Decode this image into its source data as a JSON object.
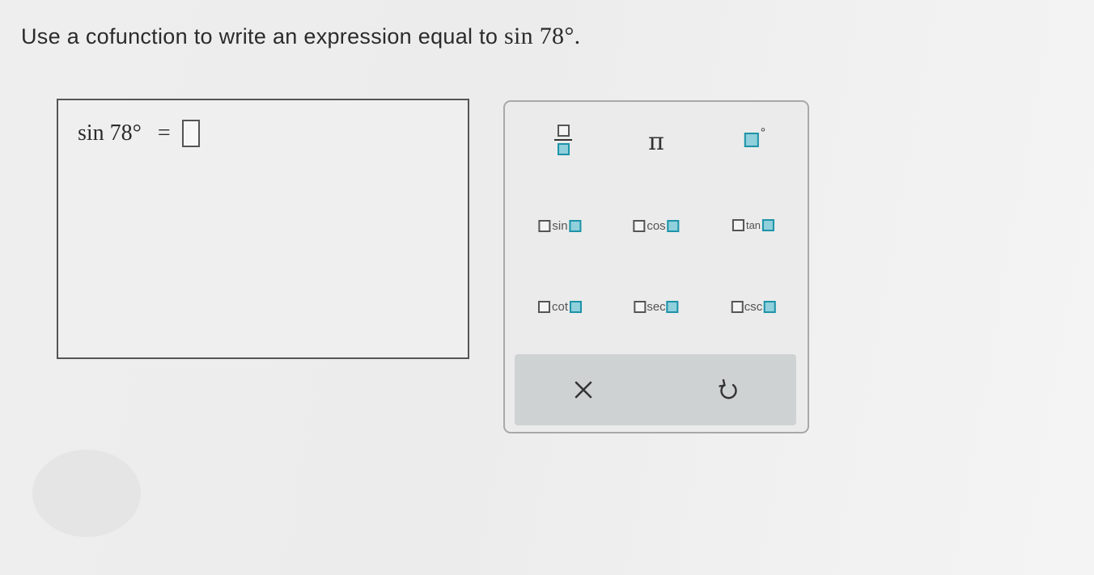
{
  "question": {
    "prefix": "Use a cofunction to write an expression equal to ",
    "math": "sin 78°."
  },
  "answer": {
    "lhs": "sin 78°",
    "equals": "=",
    "slot_value": ""
  },
  "palette": {
    "fraction": {
      "icon": "fraction-icon"
    },
    "pi": {
      "label": "π"
    },
    "degree": {
      "symbol": "°"
    },
    "functions": [
      {
        "label": "sin"
      },
      {
        "label": "cos"
      },
      {
        "label": "tan"
      },
      {
        "label": "cot"
      },
      {
        "label": "sec"
      },
      {
        "label": "csc"
      }
    ],
    "clear": {
      "icon": "close-icon"
    },
    "undo": {
      "icon": "undo-icon"
    }
  },
  "colors": {
    "accent": "#1d93a8",
    "accent_fill": "#8fd0dc",
    "action_bar": "#cfd2d2"
  }
}
